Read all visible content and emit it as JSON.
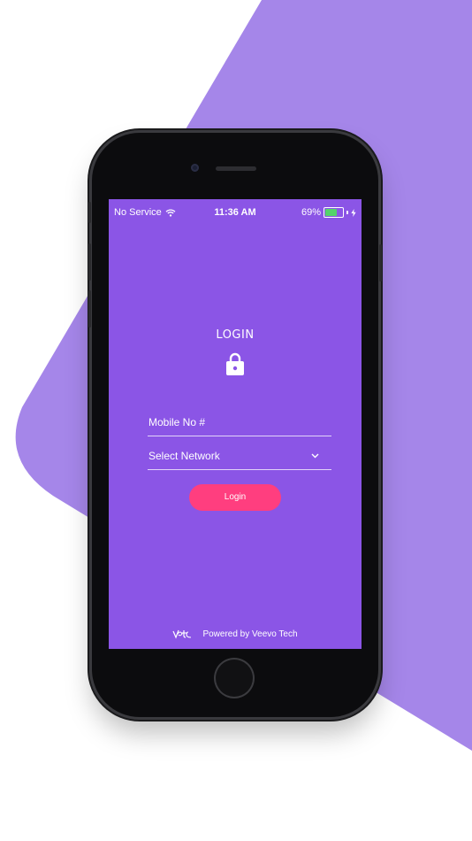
{
  "status_bar": {
    "carrier": "No Service",
    "time": "11:36 AM",
    "battery": "69%",
    "battery_level": 0.69
  },
  "login": {
    "title": "LOGIN",
    "mobile_label": "Mobile No #",
    "network_label": "Select Network",
    "button_label": "Login"
  },
  "footer": {
    "text": "Powered by Veevo Tech"
  },
  "colors": {
    "screen_bg": "#8b55e6",
    "backdrop_shape": "#a586e9",
    "button": "#ff3e7f",
    "battery_fill": "#54d36b"
  },
  "icons": [
    "wifi-icon",
    "battery-icon",
    "charging-bolt-icon",
    "lock-icon",
    "chevron-down-icon",
    "veevo-logo-icon"
  ]
}
